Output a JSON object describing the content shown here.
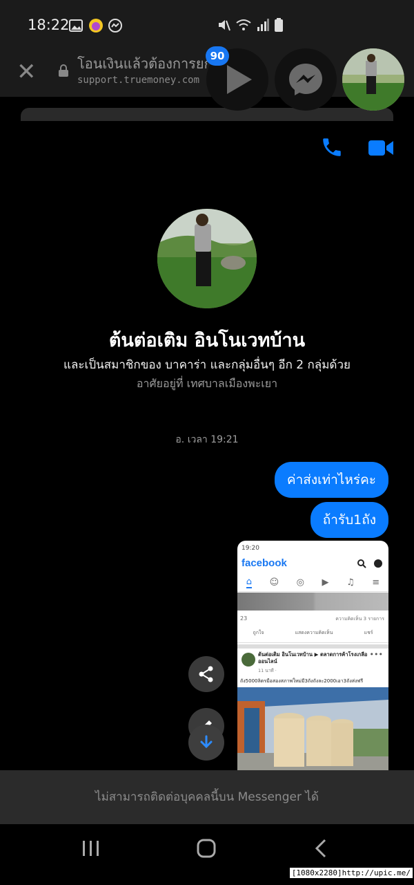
{
  "status_bar": {
    "time": "18:22",
    "icons": [
      "gallery-icon",
      "sticker-app-icon",
      "messenger-icon",
      "mute-icon",
      "wifi-icon",
      "signal-icon",
      "battery-icon"
    ]
  },
  "browser": {
    "title": "โอนเงินแล้วต้องการยก",
    "url": "support.truemoney.com"
  },
  "chat_heads": {
    "badge_count": "90"
  },
  "profile": {
    "name": "ต้นต่อเติม อินโนเวทบ้าน",
    "groups": "และเป็นสมาชิกของ บาคาร่า และกลุ่มอื่นๆ อีก 2 กลุ่มด้วย",
    "location": "อาศัยอยู่ที่ เทศบาลเมืองพะเยา"
  },
  "conversation": {
    "timestamp": "อ. เวลา 19:21",
    "messages": [
      {
        "text": "ค่าส่งเท่าไหร่คะ"
      },
      {
        "text": "ถ้ารับ1ถัง"
      }
    ]
  },
  "attachment": {
    "status_time": "19:20",
    "app_logo": "facebook",
    "reaction_count": "23",
    "comments_text": "ความคิดเห็น 3 รายการ",
    "actions": [
      "ถูกใจ",
      "แสดงความคิดเห็น",
      "แชร์"
    ],
    "post_author": "ต้นต่อเติม อินโนเวทบ้าน ▶ ตลาดการค้าโรงเกลือ ออนไลน์",
    "post_time": "11 นาที ·",
    "post_caption": "ถัง5000ลิตรมือสองสภาพใหม่มี3ถังถังละ2000เอา3ถังส่งฟรี"
  },
  "footer": {
    "cannot_contact": "ไม่สามารถติดต่อบุคคลนี้บน Messenger ได้"
  },
  "watermark": "[1080x2280]http://upic.me/",
  "colors": {
    "accent": "#0a7cff",
    "background": "#000000",
    "footer_bar": "#2b2b2b"
  }
}
